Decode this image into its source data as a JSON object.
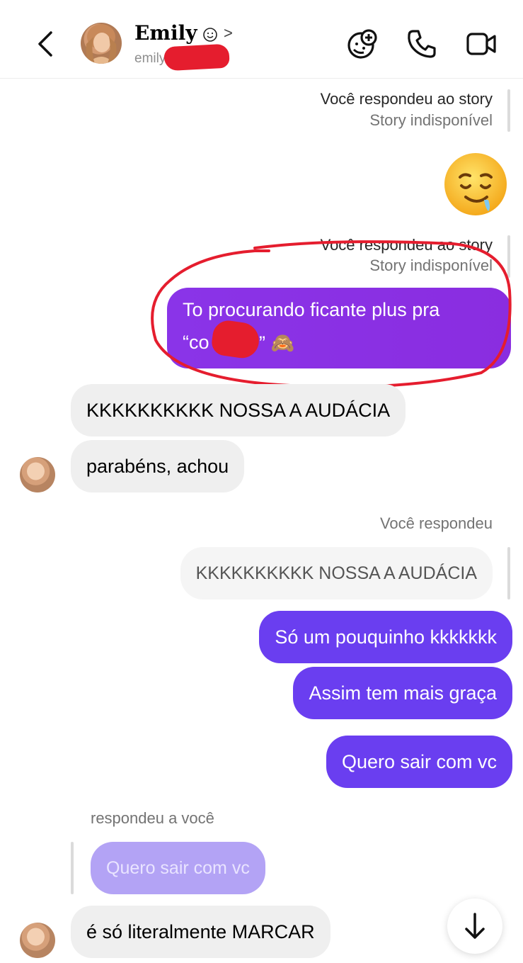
{
  "header": {
    "name": "Emily",
    "username": "emily",
    "back_icon": "chevron-left-icon",
    "info_icon": "smiley-icon",
    "info_chevron": ">",
    "actions": [
      "video-effects-icon",
      "phone-icon",
      "video-camera-icon"
    ]
  },
  "messages": {
    "story_reply_1": {
      "label": "Você respondeu ao story",
      "sub": "Story indisponível"
    },
    "emoji_1": "🤤",
    "story_reply_2": {
      "label": "Você respondeu ao story",
      "sub": "Story indisponível"
    },
    "out_1": {
      "line1": "To procurando ficante plus pra",
      "line2": "“co",
      "line2_end": "” 🙈"
    },
    "in_1": "KKKKKKKKKK NOSSA A AUDÁCIA",
    "in_2": "parabéns, achou",
    "you_replied_label": "Você respondeu",
    "quoted_1": "KKKKKKKKKK NOSSA A AUDÁCIA",
    "out_2": "Só um pouquinho kkkkkkk",
    "out_3": "Assim tem mais graça",
    "out_4": "Quero sair com vc",
    "replied_to_you_label": "respondeu a você",
    "quoted_2": "Quero sair com vc",
    "in_3": "é só literalmente MARCAR"
  },
  "scroll_down_icon": "arrow-down-icon",
  "colors": {
    "outgoing_bubble": "#6a3ef0",
    "outgoing_bubble_first": "#8430e0",
    "incoming_bubble": "#efefef",
    "annotation_red": "#e51d2e",
    "quoted_outgoing": "#b3a3f5"
  }
}
